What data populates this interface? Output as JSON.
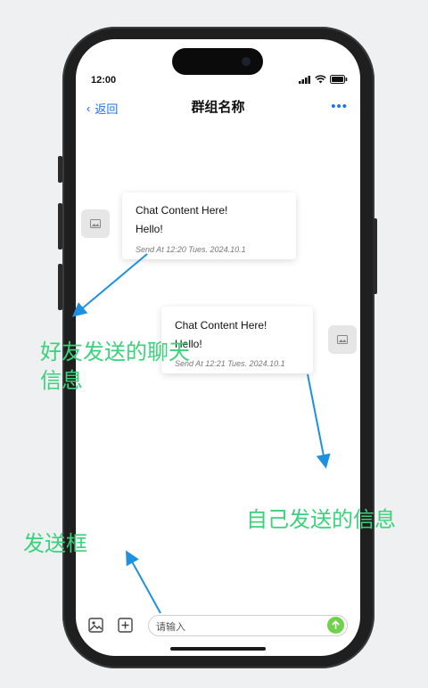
{
  "status": {
    "time": "12:00"
  },
  "nav": {
    "back_label": "返回",
    "title": "群组名称",
    "more": "•••"
  },
  "messages": [
    {
      "side": "left",
      "line1": "Chat Content Here!",
      "line2": "Hello!",
      "meta": "Send At 12:20 Tues. 2024.10.1"
    },
    {
      "side": "right",
      "line1": "Chat Content Here!",
      "line2": "Hello!",
      "meta": "Send At 12:21 Tues. 2024.10.1"
    }
  ],
  "composer": {
    "placeholder": "请输入"
  },
  "annotations": {
    "friend_msg": "好友发送的聊天\n信息",
    "self_msg": "自己发送的信息",
    "send_box": "发送框"
  },
  "colors": {
    "accent": "#1a73e8",
    "send": "#6fd24a",
    "annotation": "#3ad27a",
    "arrow": "#1e90e0"
  }
}
